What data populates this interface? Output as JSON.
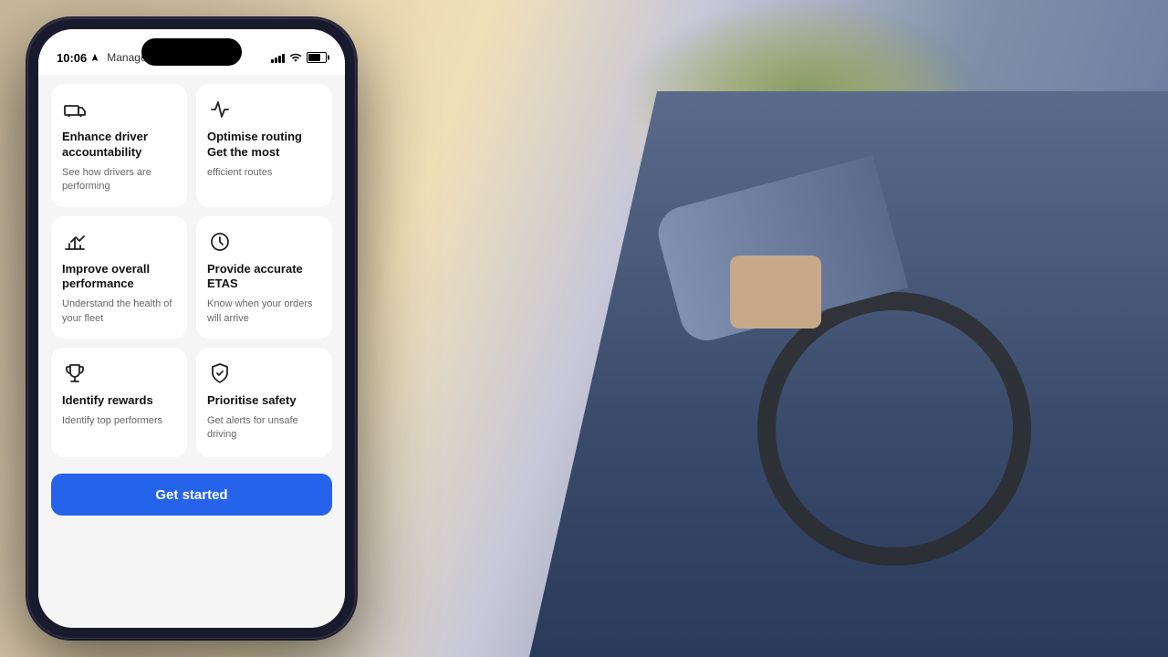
{
  "background": {
    "description": "Driver in cab background photo"
  },
  "phone": {
    "status_bar": {
      "time": "10:06",
      "location_icon": "location-arrow",
      "app_name": "Manage V",
      "signal": "signal-icon",
      "wifi": "wifi-icon",
      "battery": "battery-icon"
    },
    "cards": [
      {
        "id": "enhance-driver",
        "icon": "truck-icon",
        "title": "Enhance driver accountability",
        "description": "See how drivers are performing"
      },
      {
        "id": "optimise-routing",
        "icon": "routing-icon",
        "title": "Optimise routing Get the most",
        "description": "efficient routes"
      },
      {
        "id": "improve-performance",
        "icon": "performance-icon",
        "title": "Improve overall performance",
        "description": "Understand the health of your fleet"
      },
      {
        "id": "provide-etas",
        "icon": "clock-icon",
        "title": "Provide accurate ETAS",
        "description": "Know when your orders will arrive"
      },
      {
        "id": "identify-rewards",
        "icon": "trophy-icon",
        "title": "Identify rewards",
        "description": "Identify top performers"
      },
      {
        "id": "prioritise-safety",
        "icon": "shield-icon",
        "title": "Prioritise safety",
        "description": "Get alerts for unsafe driving"
      }
    ],
    "cta_button": {
      "label": "Get started"
    }
  }
}
